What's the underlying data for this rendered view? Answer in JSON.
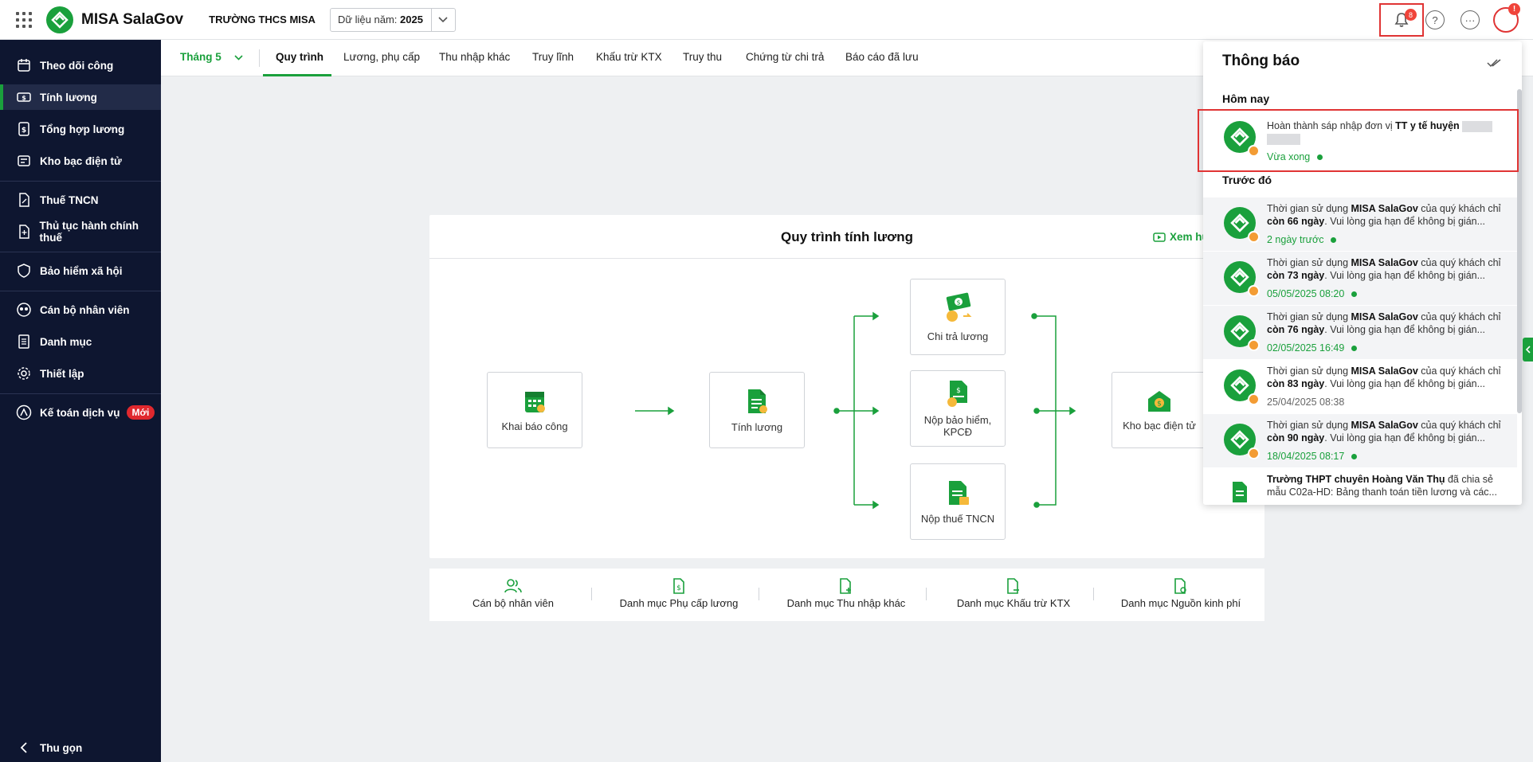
{
  "header": {
    "app_name": "MISA SalaGov",
    "school": "TRƯỜNG THCS MISA",
    "year_label": "Dữ liệu năm:",
    "year_value": "2025",
    "bell_badge": "8",
    "help_icon": "?",
    "more_icon": "···",
    "avatar_badge": "!"
  },
  "sidebar": {
    "items": [
      {
        "label": "Theo dõi công",
        "icon": "calendar-icon"
      },
      {
        "label": "Tính lương",
        "icon": "salary-icon"
      },
      {
        "label": "Tổng hợp lương",
        "icon": "summary-icon"
      },
      {
        "label": "Kho bạc điện tử",
        "icon": "treasury-icon"
      },
      {
        "label": "Thuế TNCN",
        "icon": "tax-icon"
      },
      {
        "label": "Thủ tục hành chính thuế",
        "icon": "tax-procedure-icon"
      },
      {
        "label": "Bảo hiểm xã hội",
        "icon": "insurance-icon"
      },
      {
        "label": "Cán bộ nhân viên",
        "icon": "staff-icon"
      },
      {
        "label": "Danh mục",
        "icon": "catalog-icon"
      },
      {
        "label": "Thiết lập",
        "icon": "settings-icon"
      },
      {
        "label": "Kế toán dịch vụ",
        "icon": "accounting-icon",
        "badge": "Mới"
      }
    ],
    "collapse_label": "Thu gọn"
  },
  "tabs": {
    "month": "Tháng 5",
    "items": [
      "Quy trình",
      "Lương, phụ cấp",
      "Thu nhập khác",
      "Truy lĩnh",
      "Khấu trừ KTX",
      "Truy thu",
      "Chứng từ chi trả",
      "Báo cáo đã lưu"
    ],
    "active": "Quy trình"
  },
  "flow": {
    "title": "Quy trình tính lương",
    "guide_link": "Xem hư",
    "nodes": {
      "khai_bao_cong": "Khai báo công",
      "tinh_luong": "Tính lương",
      "chi_tra_luong": "Chi trả lương",
      "nop_bao_hiem_line1": "Nộp bảo hiểm,",
      "nop_bao_hiem_line2": "KPCĐ",
      "nop_thue": "Nộp thuế TNCN",
      "kho_bac": "Kho bạc điện tử"
    }
  },
  "quick_links": [
    "Cán bộ nhân viên",
    "Danh mục Phụ cấp lương",
    "Danh mục Thu nhập khác",
    "Danh mục Khấu trừ KTX",
    "Danh mục Nguồn kinh phí"
  ],
  "notifications": {
    "title": "Thông báo",
    "today_label": "Hôm nay",
    "earlier_label": "Trước đó",
    "today": {
      "text_prefix": "Hoàn thành sáp nhập đơn vị ",
      "text_bold": "TT y tế huyện",
      "time": "Vừa xong"
    },
    "earlier": [
      {
        "days": "còn 66 ngày",
        "time": "2 ngày trước",
        "unread": true
      },
      {
        "days": "còn 73 ngày",
        "time": "05/05/2025 08:20",
        "unread": true
      },
      {
        "days": "còn 76 ngày",
        "time": "02/05/2025 16:49",
        "unread": true
      },
      {
        "days": "còn 83 ngày",
        "time": "25/04/2025 08:38",
        "unread": false
      },
      {
        "days": "còn 90 ngày",
        "time": "18/04/2025 08:17",
        "unread": true
      }
    ],
    "msg_prefix": "Thời gian sử dụng ",
    "msg_brand": "MISA SalaGov",
    "msg_mid": " của quý khách chỉ ",
    "msg_suffix": ". Vui lòng gia hạn để không bị gián...",
    "last": {
      "bold": "Trường THPT chuyên Hoàng Văn Thụ",
      "rest": " đã chia sẻ mẫu C02a-HD: Bảng thanh toán tiền lương và các..."
    }
  },
  "colors": {
    "brand_green": "#1aa03c",
    "sidebar_bg": "#0e1630",
    "alert_red": "#e03434"
  }
}
